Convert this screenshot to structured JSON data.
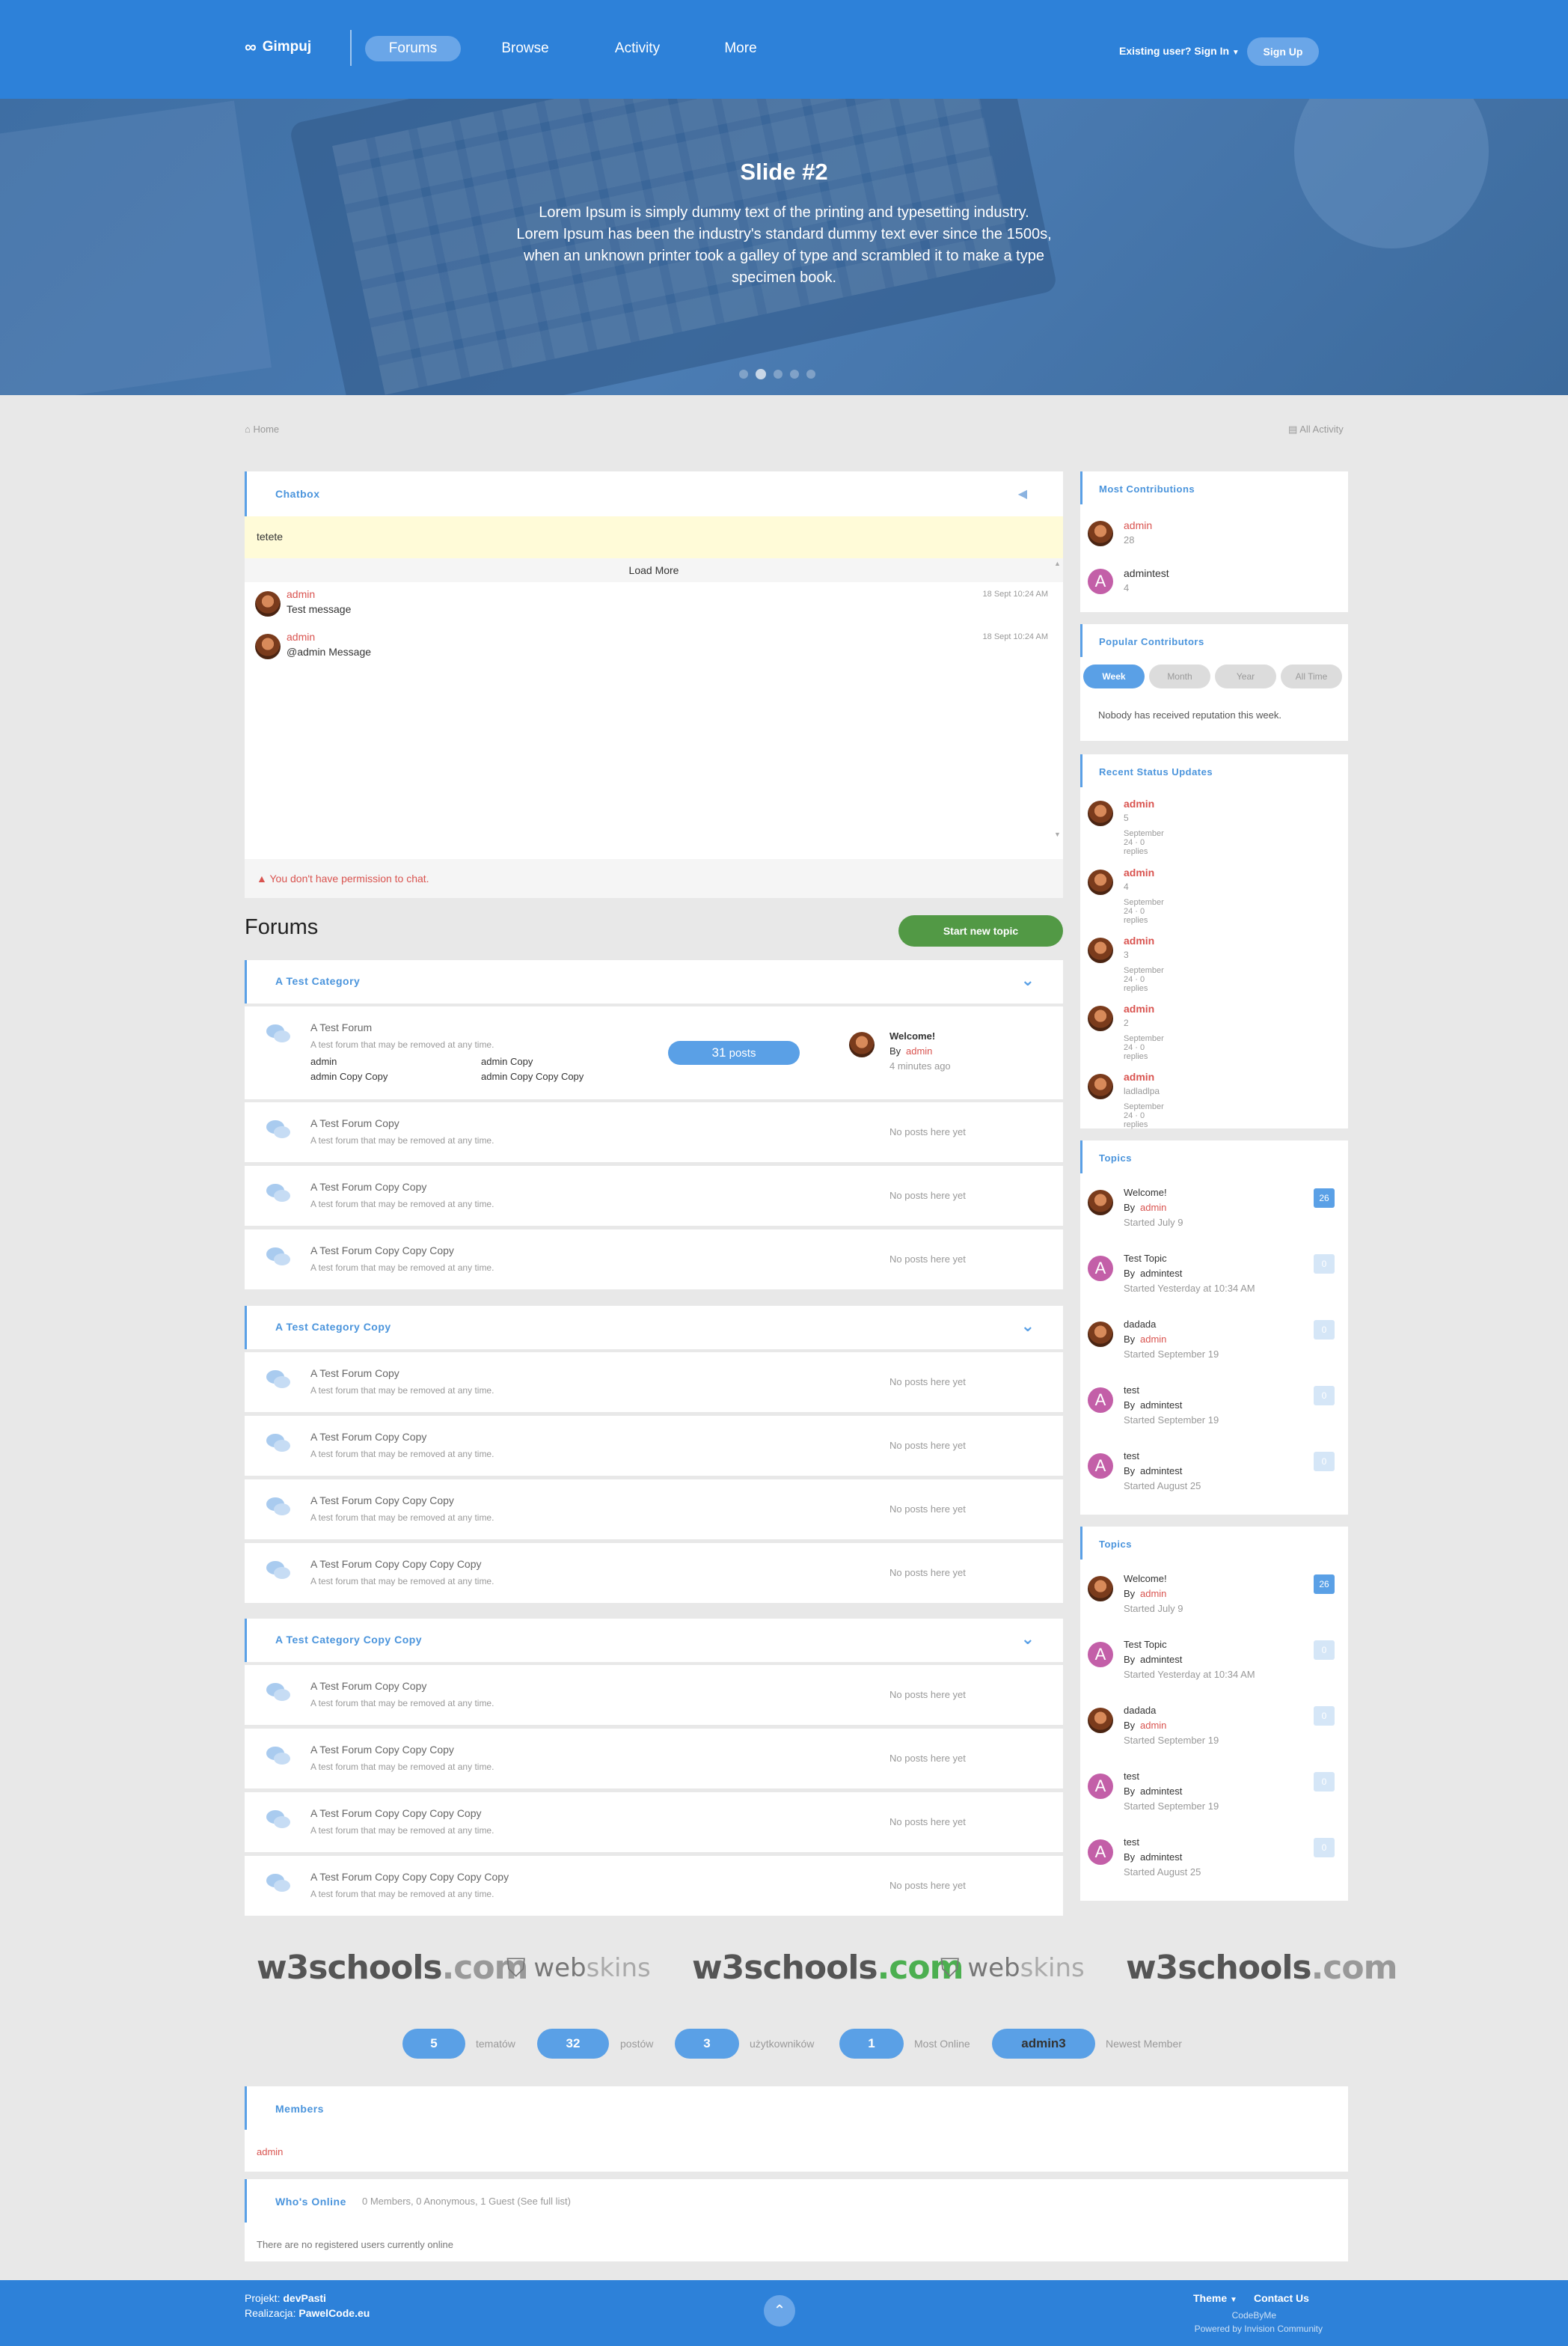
{
  "header": {
    "logo": "Gimpuj",
    "nav": [
      "Forums",
      "Browse",
      "Activity",
      "More"
    ],
    "signin": "Existing user? Sign In",
    "signup": "Sign Up"
  },
  "hero": {
    "title": "Slide #2",
    "text": "Lorem Ipsum is simply dummy text of the printing and typesetting industry. Lorem Ipsum has been the industry's standard dummy text ever since the 1500s, when an unknown printer took a galley of type and scrambled it to make a type specimen book."
  },
  "breadcrumb": {
    "home": "Home",
    "all_activity": "All Activity"
  },
  "chatbox": {
    "title": "Chatbox",
    "input_value": "tetete",
    "load_more": "Load More",
    "messages": [
      {
        "name": "admin",
        "text": "Test message",
        "time": "18 Sept 10:24 AM"
      },
      {
        "name": "admin",
        "text": "@admin Message",
        "time": "18 Sept 10:24 AM"
      }
    ],
    "warning": "You don't have permission to chat."
  },
  "forums": {
    "title": "Forums",
    "start_topic": "Start new topic",
    "categories": [
      {
        "name": "A Test Category"
      },
      {
        "name": "A Test Category Copy"
      },
      {
        "name": "A Test Category Copy Copy"
      }
    ],
    "desc": "A test forum that may be removed at any time.",
    "no_posts": "No posts here yet",
    "first": {
      "name": "A Test Forum",
      "subs": [
        "admin",
        "admin Copy",
        "admin Copy Copy",
        "admin Copy Copy Copy"
      ],
      "posts_count": "31",
      "posts_label": "posts",
      "last_title": "Welcome!",
      "last_by": "By",
      "last_author": "admin",
      "last_time": "4 minutes ago"
    },
    "rows": [
      "A Test Forum Copy",
      "A Test Forum Copy Copy",
      "A Test Forum Copy Copy Copy",
      "A Test Forum Copy",
      "A Test Forum Copy Copy",
      "A Test Forum Copy Copy Copy",
      "A Test Forum Copy Copy Copy Copy",
      "A Test Forum Copy Copy",
      "A Test Forum Copy Copy Copy",
      "A Test Forum Copy Copy Copy Copy",
      "A Test Forum Copy Copy Copy Copy Copy"
    ]
  },
  "sidebar": {
    "most_contrib": {
      "title": "Most Contributions",
      "items": [
        {
          "name": "admin",
          "count": "28"
        },
        {
          "name": "admintest",
          "count": "4"
        }
      ]
    },
    "popular": {
      "title": "Popular Contributors",
      "tabs": [
        "Week",
        "Month",
        "Year",
        "All Time"
      ],
      "empty": "Nobody has received reputation this week."
    },
    "status": {
      "title": "Recent Status Updates",
      "items": [
        {
          "name": "admin",
          "text": "5",
          "meta": "September 24 · 0 replies"
        },
        {
          "name": "admin",
          "text": "4",
          "meta": "September 24 · 0 replies"
        },
        {
          "name": "admin",
          "text": "3",
          "meta": "September 24 · 0 replies"
        },
        {
          "name": "admin",
          "text": "2",
          "meta": "September 24 · 0 replies"
        },
        {
          "name": "admin",
          "text": "ladladlpa",
          "meta": "September 24 · 0 replies"
        }
      ]
    },
    "topics": {
      "title": "Topics",
      "by": "By",
      "items": [
        {
          "title": "Welcome!",
          "author": "admin",
          "started": "Started July 9",
          "count": "26"
        },
        {
          "title": "Test Topic",
          "author": "admintest",
          "started": "Started Yesterday at 10:34 AM",
          "count": "0"
        },
        {
          "title": "dadada",
          "author": "admin",
          "started": "Started September 19",
          "count": "0"
        },
        {
          "title": "test",
          "author": "admintest",
          "started": "Started September 19",
          "count": "0"
        },
        {
          "title": "test",
          "author": "admintest",
          "started": "Started August 25",
          "count": "0"
        }
      ]
    }
  },
  "logos": {
    "w3": "w3schools",
    "w3_ext": ".com",
    "web": "web",
    "skins": "skins"
  },
  "stats": [
    {
      "value": "5",
      "label": "tematów"
    },
    {
      "value": "32",
      "label": "postów"
    },
    {
      "value": "3",
      "label": "użytkowników"
    },
    {
      "value": "1",
      "label": "Most Online"
    },
    {
      "value": "admin3",
      "label": "Newest Member"
    }
  ],
  "members": {
    "title": "Members",
    "name": "admin"
  },
  "whos_online": {
    "title": "Who's Online",
    "summary": "0 Members, 0 Anonymous, 1 Guest (See full list)",
    "empty": "There are no registered users currently online"
  },
  "footer": {
    "projekt_label": "Projekt:",
    "projekt_value": "devPasti",
    "realizacja_label": "Realizacja:",
    "realizacja_value": "PawelCode.eu",
    "theme": "Theme",
    "contact": "Contact Us",
    "codeby": "CodeByMe",
    "powered": "Powered by Invision Community"
  },
  "colors": {
    "brand": "#2d81d9",
    "accent": "#5aa0e6",
    "author": "#d9534f",
    "start_topic": "#529945"
  }
}
